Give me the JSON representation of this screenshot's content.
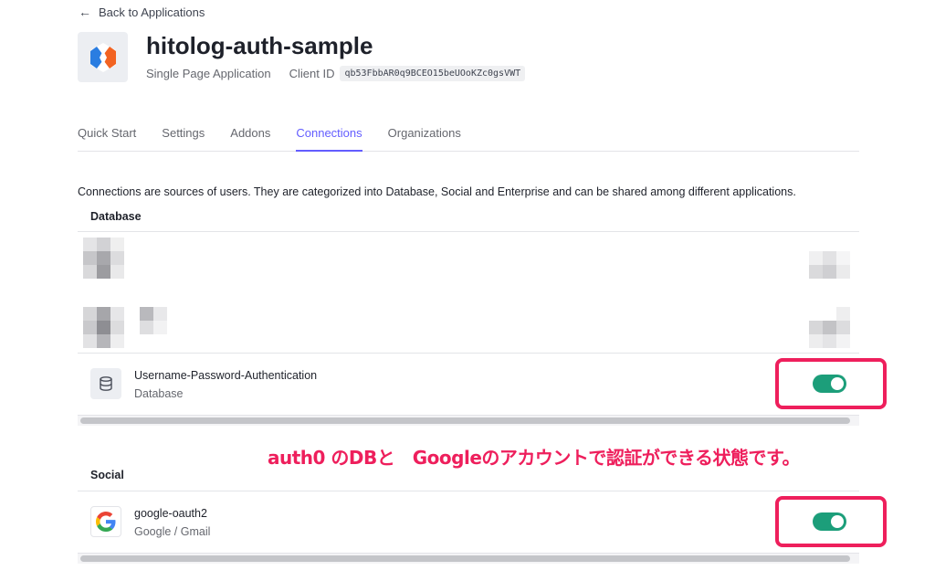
{
  "back_link": {
    "label": "Back to Applications"
  },
  "app": {
    "name": "hitolog-auth-sample",
    "type": "Single Page Application",
    "client_id_label": "Client ID",
    "client_id": "qb53FbbAR0q9BCEO15beUOoKZc0gsVWT"
  },
  "tabs": [
    {
      "label": "Quick Start",
      "active": false
    },
    {
      "label": "Settings",
      "active": false
    },
    {
      "label": "Addons",
      "active": false
    },
    {
      "label": "Connections",
      "active": true
    },
    {
      "label": "Organizations",
      "active": false
    }
  ],
  "description": "Connections are sources of users. They are categorized into Database, Social and Enterprise and can be shared among different applications.",
  "database": {
    "heading": "Database",
    "connection": {
      "name": "Username-Password-Authentication",
      "subtitle": "Database",
      "enabled": true,
      "icon": "database-icon"
    }
  },
  "social": {
    "heading": "Social",
    "connection": {
      "name": "google-oauth2",
      "subtitle": "Google / Gmail",
      "enabled": true,
      "icon": "google-icon"
    }
  },
  "annotation": "auth0 のDBと　Googleのアカウントで認証ができる状態です。",
  "colors": {
    "accent": "#635dff",
    "toggle_on": "#1c9e7a",
    "highlight": "#ee1f5c"
  }
}
